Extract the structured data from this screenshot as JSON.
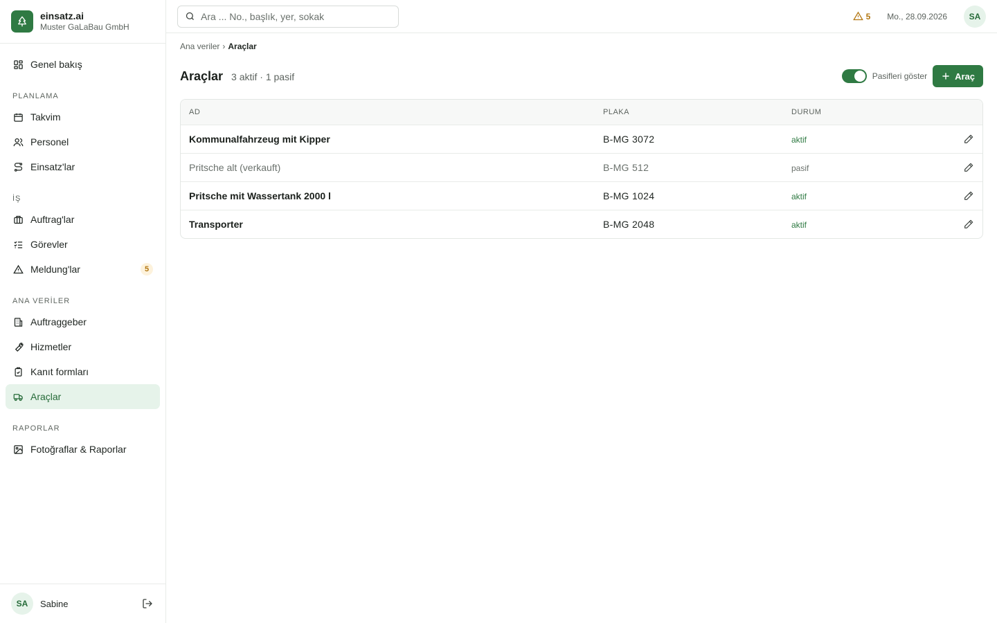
{
  "brand": {
    "name": "einsatz.ai",
    "company": "Muster GaLaBau GmbH"
  },
  "nav": {
    "overview": "Genel bakış",
    "section_planning": "PLANLAMA",
    "calendar": "Takvim",
    "staff": "Personel",
    "assignments": "Einsatz'lar",
    "section_work": "İŞ",
    "orders": "Auftrag'lar",
    "tasks": "Görevler",
    "reports_issues": "Meldung'lar",
    "reports_issues_badge": "5",
    "section_master": "ANA VERİLER",
    "clients": "Auftraggeber",
    "services": "Hizmetler",
    "proof_forms": "Kanıt formları",
    "vehicles": "Araçlar",
    "section_reports": "RAPORLAR",
    "photos_reports": "Fotoğraflar & Raporlar"
  },
  "user": {
    "initials": "SA",
    "name": "Sabine"
  },
  "topbar": {
    "search_placeholder": "Ara ... No., başlık, yer, sokak",
    "alert_count": "5",
    "date": "Mo., 28.09.2026",
    "avatar_initials": "SA"
  },
  "breadcrumb": {
    "parent": "Ana veriler",
    "separator": "›",
    "current": "Araçlar"
  },
  "page": {
    "title": "Araçlar",
    "subtitle": "3 aktif · 1 pasif",
    "toggle_label": "Pasifleri göster",
    "add_label": "Araç"
  },
  "table": {
    "headers": {
      "name": "AD",
      "plate": "PLAKA",
      "status": "DURUM"
    },
    "rows": [
      {
        "name": "Kommunalfahrzeug mit Kipper",
        "plate": "B-MG 3072",
        "status": "aktif"
      },
      {
        "name": "Pritsche alt (verkauft)",
        "plate": "B-MG 512",
        "status": "pasif"
      },
      {
        "name": "Pritsche mit Wassertank 2000 l",
        "plate": "B-MG 1024",
        "status": "aktif"
      },
      {
        "name": "Transporter",
        "plate": "B-MG 2048",
        "status": "aktif"
      }
    ]
  },
  "colors": {
    "accent": "#2f7a43",
    "active_bg": "#e6f3ea",
    "warning": "#b27611"
  }
}
